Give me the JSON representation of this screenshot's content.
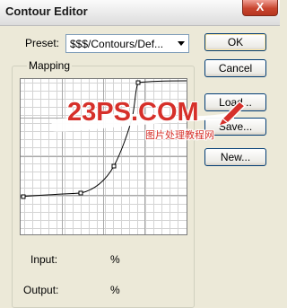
{
  "window": {
    "title": "Contour Editor",
    "close_glyph": "X"
  },
  "preset": {
    "label": "Preset:",
    "value": "$$$/Contours/Def..."
  },
  "buttons": {
    "ok": "OK",
    "cancel": "Cancel",
    "load": "Load...",
    "save": "Save...",
    "new": "New..."
  },
  "mapping": {
    "label": "Mapping"
  },
  "readout": {
    "input_label": "Input:",
    "input_unit": "%",
    "output_label": "Output:",
    "output_unit": "%"
  },
  "watermark": {
    "brand": "23PS.COM",
    "subtitle": "图片处理教程网"
  },
  "icons": {
    "dropdown": "chevron-down-icon",
    "close": "close-icon",
    "brush": "brush-icon"
  },
  "colors": {
    "watermark_red": "#d6302a",
    "accent_blue": "#003c74"
  }
}
